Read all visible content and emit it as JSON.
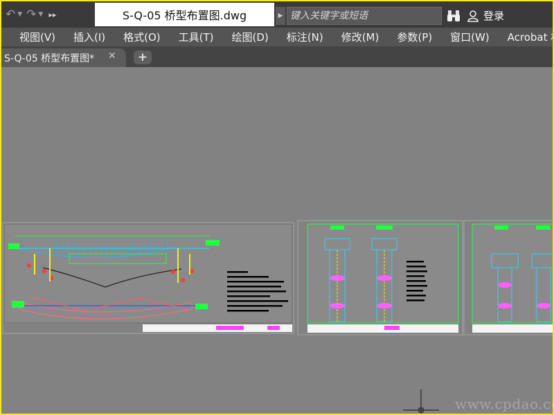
{
  "titlebar": {
    "doc_title": "S-Q-05 桥型布置图.dwg",
    "search_placeholder": "键入关键字或短语",
    "login_label": "登录"
  },
  "menu": {
    "items": [
      "视图(V)",
      "插入(I)",
      "格式(O)",
      "工具(T)",
      "绘图(D)",
      "标注(N)",
      "修改(M)",
      "参数(P)",
      "窗口(W)",
      "Acrobat 格"
    ]
  },
  "tabs": {
    "active_label": "S-Q-05 桥型布置图*"
  },
  "watermark": "www.cpdao.com",
  "colors": {
    "frame": "#f4ea1c",
    "background": "#818181"
  }
}
